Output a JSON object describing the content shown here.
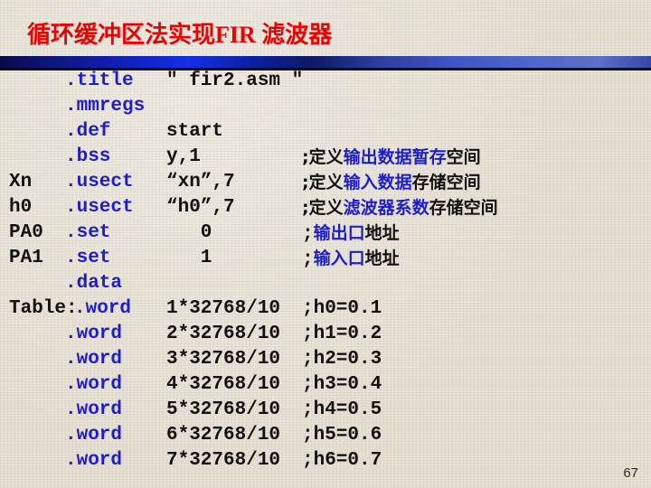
{
  "slide": {
    "title": "循环缓冲区法实现FIR 滤波器",
    "page_number": "67",
    "title_color": "#ee0000",
    "code_keyword_color": "#1e1ec8",
    "code_text_color": "#111111",
    "background_color": "#e7e1d5",
    "rule_gradient_from": "#0a0a4a",
    "rule_gradient_to": "#3f56c4"
  },
  "code": {
    "lines": [
      {
        "label": "",
        "directive": ".title",
        "args": "\" fir2.asm \"",
        "comment_lead": "",
        "comment_mid": "",
        "comment_tail": ""
      },
      {
        "label": "",
        "directive": ".mmregs",
        "args": "",
        "comment_lead": "",
        "comment_mid": "",
        "comment_tail": ""
      },
      {
        "label": "",
        "directive": ".def",
        "args": "start",
        "comment_lead": "",
        "comment_mid": "",
        "comment_tail": ""
      },
      {
        "label": "",
        "directive": ".bss",
        "args": "y,1",
        "comment_lead": ";定义",
        "comment_mid": "输出数据暂存",
        "comment_tail": "空间"
      },
      {
        "label": "Xn",
        "directive": ".usect",
        "args": "“xn”,7",
        "comment_lead": ";定义",
        "comment_mid": "输入数据",
        "comment_tail": "存储空间"
      },
      {
        "label": "h0",
        "directive": ".usect",
        "args": "“h0”,7",
        "comment_lead": ";定义",
        "comment_mid": "滤波器系数",
        "comment_tail": "存储空间"
      },
      {
        "label": "PA0",
        "directive": ".set",
        "args": "   0",
        "comment_lead": ";",
        "comment_mid": "输出口",
        "comment_tail": "地址"
      },
      {
        "label": "PA1",
        "directive": ".set",
        "args": "   1",
        "comment_lead": ";",
        "comment_mid": "输入口",
        "comment_tail": "地址"
      },
      {
        "label": "",
        "directive": ".data",
        "args": "",
        "comment_lead": "",
        "comment_mid": "",
        "comment_tail": ""
      },
      {
        "label": "Table:",
        "directive": ".word",
        "args": "1*32768/10",
        "comment_lead": ";h0=0.1",
        "comment_mid": "",
        "comment_tail": ""
      },
      {
        "label": "",
        "directive": ".word",
        "args": "2*32768/10",
        "comment_lead": ";h1=0.2",
        "comment_mid": "",
        "comment_tail": ""
      },
      {
        "label": "",
        "directive": ".word",
        "args": "3*32768/10",
        "comment_lead": ";h2=0.3",
        "comment_mid": "",
        "comment_tail": ""
      },
      {
        "label": "",
        "directive": ".word",
        "args": "4*32768/10",
        "comment_lead": ";h3=0.4",
        "comment_mid": "",
        "comment_tail": ""
      },
      {
        "label": "",
        "directive": ".word",
        "args": "5*32768/10",
        "comment_lead": ";h4=0.5",
        "comment_mid": "",
        "comment_tail": ""
      },
      {
        "label": "",
        "directive": ".word",
        "args": "6*32768/10",
        "comment_lead": ";h5=0.6",
        "comment_mid": "",
        "comment_tail": ""
      },
      {
        "label": "",
        "directive": ".word",
        "args": "7*32768/10",
        "comment_lead": ";h6=0.7",
        "comment_mid": "",
        "comment_tail": ""
      }
    ]
  }
}
